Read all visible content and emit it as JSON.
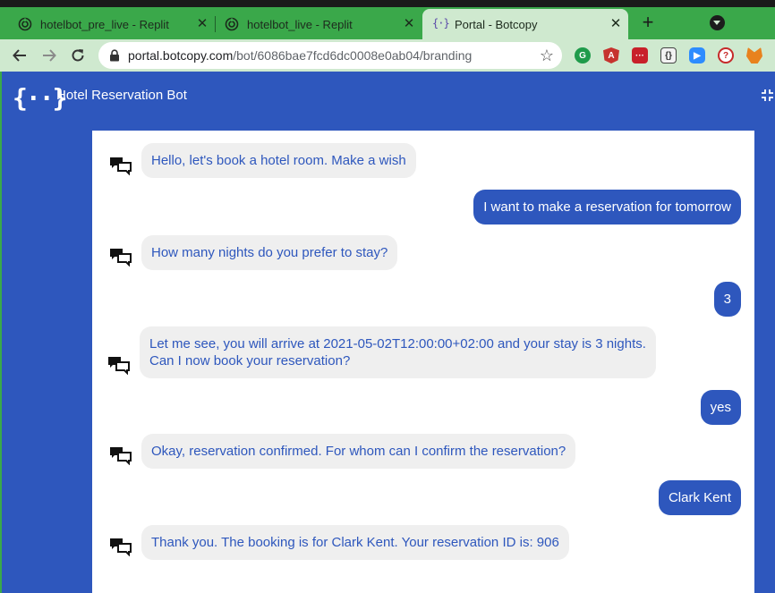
{
  "browser": {
    "tabs": [
      {
        "title": "hotelbot_pre_live - Replit",
        "icon": "replit-icon"
      },
      {
        "title": "hotelbot_live - Replit",
        "icon": "replit-icon"
      },
      {
        "title": "Portal - Botcopy",
        "icon": "botcopy-icon",
        "favicon_text": "{·}"
      }
    ],
    "active_tab": 2,
    "url_host": "portal.botcopy.com",
    "url_path": "/bot/6086bae7fcd6dc0008e0ab04/branding",
    "new_tab_label": "+",
    "close_glyph": "✕"
  },
  "colors": {
    "brand_blue": "#2e57bd",
    "tab_strip": "#3aa84a",
    "active_tab": "#cfe9cf",
    "bot_bubble": "#efefef"
  },
  "header": {
    "logo_text": "{··}",
    "title": "Hotel Reservation Bot"
  },
  "messages": [
    {
      "from": "bot",
      "text": "Hello, let's book a hotel room. Make a wish"
    },
    {
      "from": "user",
      "text": "I want to make a reservation for tomorrow"
    },
    {
      "from": "bot",
      "text": "How many nights do you prefer to stay?"
    },
    {
      "from": "user",
      "text": "3"
    },
    {
      "from": "bot",
      "line1": "Let me see, you will arrive at 2021-05-02T12:00:00+02:00 and your stay is 3 nights.",
      "line2": "Can I now book your reservation?"
    },
    {
      "from": "user",
      "text": "yes"
    },
    {
      "from": "bot",
      "text": "Okay, reservation confirmed. For whom can I confirm the reservation?"
    },
    {
      "from": "user",
      "text": "Clark Kent"
    },
    {
      "from": "bot",
      "text": "Thank you. The booking is for Clark Kent. Your reservation ID is: 906"
    }
  ]
}
